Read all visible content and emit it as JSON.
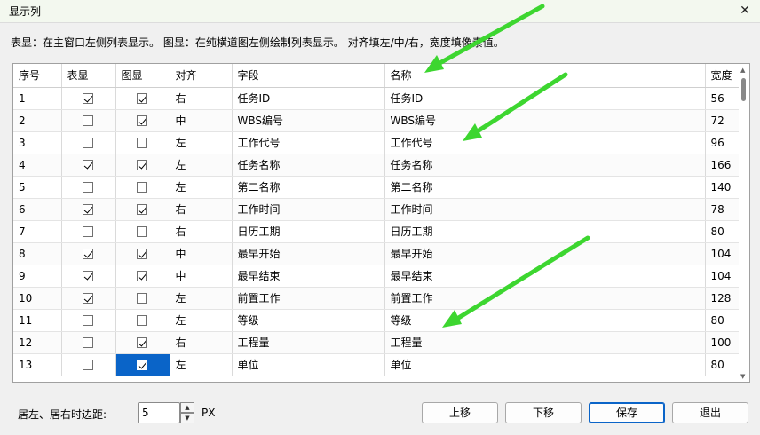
{
  "window": {
    "title": "显示列",
    "close_glyph": "✕"
  },
  "description": "表显：在主窗口左侧列表显示。 图显：在纯横道图左侧绘制列表显示。 对齐填左/中/右，宽度填像素值。",
  "columns": [
    "序号",
    "表显",
    "图显",
    "对齐",
    "字段",
    "名称",
    "宽度"
  ],
  "rows": [
    {
      "no": "1",
      "table": true,
      "chart": true,
      "align": "右",
      "field": "任务ID",
      "name": "任务ID",
      "width": "56"
    },
    {
      "no": "2",
      "table": false,
      "chart": true,
      "align": "中",
      "field": "WBS编号",
      "name": "WBS编号",
      "width": "72"
    },
    {
      "no": "3",
      "table": false,
      "chart": false,
      "align": "左",
      "field": "工作代号",
      "name": "工作代号",
      "width": "96"
    },
    {
      "no": "4",
      "table": true,
      "chart": true,
      "align": "左",
      "field": "任务名称",
      "name": "任务名称",
      "width": "166"
    },
    {
      "no": "5",
      "table": false,
      "chart": false,
      "align": "左",
      "field": "第二名称",
      "name": "第二名称",
      "width": "140"
    },
    {
      "no": "6",
      "table": true,
      "chart": true,
      "align": "右",
      "field": "工作时间",
      "name": "工作时间",
      "width": "78"
    },
    {
      "no": "7",
      "table": false,
      "chart": false,
      "align": "右",
      "field": "日历工期",
      "name": "日历工期",
      "width": "80"
    },
    {
      "no": "8",
      "table": true,
      "chart": true,
      "align": "中",
      "field": "最早开始",
      "name": "最早开始",
      "width": "104"
    },
    {
      "no": "9",
      "table": true,
      "chart": true,
      "align": "中",
      "field": "最早结束",
      "name": "最早结束",
      "width": "104"
    },
    {
      "no": "10",
      "table": true,
      "chart": false,
      "align": "左",
      "field": "前置工作",
      "name": "前置工作",
      "width": "128"
    },
    {
      "no": "11",
      "table": false,
      "chart": false,
      "align": "左",
      "field": "等级",
      "name": "等级",
      "width": "80"
    },
    {
      "no": "12",
      "table": false,
      "chart": true,
      "align": "右",
      "field": "工程量",
      "name": "工程量",
      "width": "100"
    },
    {
      "no": "13",
      "table": false,
      "chart": true,
      "align": "左",
      "field": "单位",
      "name": "单位",
      "width": "80",
      "selected_chart": true
    }
  ],
  "margin": {
    "label": "居左、居右时边距:",
    "value": "5",
    "unit": "PX"
  },
  "buttons": {
    "up": "上移",
    "down": "下移",
    "save": "保存",
    "exit": "退出"
  },
  "colors": {
    "selection": "#0a64c8",
    "annotation_arrow": "#3dd630"
  }
}
